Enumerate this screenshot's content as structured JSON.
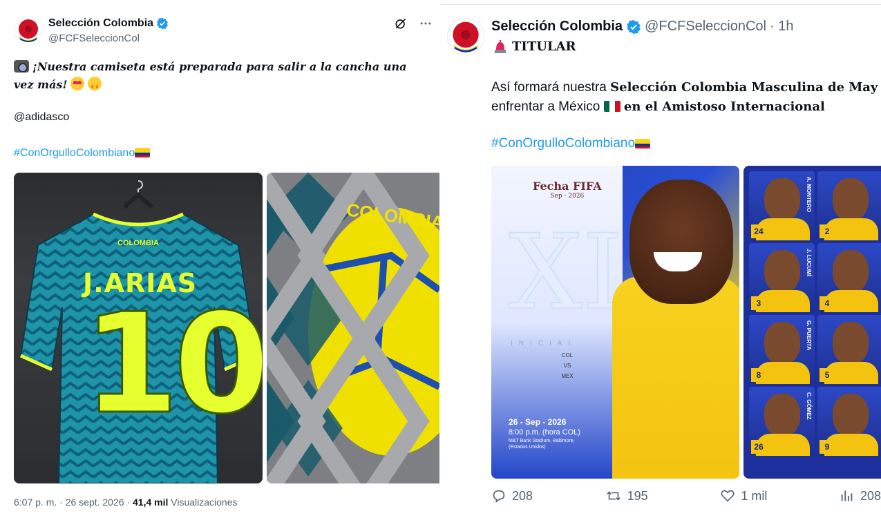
{
  "left_tweet": {
    "author_name": "Selección Colombia",
    "author_handle": "@FCFSeleccionCol",
    "text_line": "¡Nuestra camiseta está preparada para salir a la cancha una vez más!",
    "mention": "@adidasco",
    "hashtag": "#ConOrgulloColombiano",
    "jersey_name": "J.ARIAS",
    "jersey_number": "10",
    "jersey_badge": "COLOMBIA",
    "ball_text": "COLOMBIA",
    "timestamp": "6:07 p. m. · 26 sept. 2026 · ",
    "views_count": "41,4 mil",
    "views_label": " Visualizaciones",
    "icons": [
      "grok-icon",
      "more-icon",
      "verified-badge-icon"
    ]
  },
  "right_tweet": {
    "author_name": "Selección Colombia",
    "author_handle": "@FCFSeleccionCol",
    "time_ago": "· 1h",
    "titular": "TITULAR",
    "text_part1": "Así formará nuestra ",
    "text_bold1": "Selección Colombia Masculina de May",
    "text_part2": "enfrentar a México ",
    "text_bold2": "en el Amistoso Internacional",
    "hashtag": "#ConOrgulloColombiano",
    "poster": {
      "fecha_title": "Fecha FIFA",
      "fecha_sub": "Sep - 2026",
      "xi": "XI",
      "inicial": "INICIAL",
      "col": "COL",
      "vs": "VS",
      "mex": "MEX",
      "date": "26 - Sep - 2026",
      "time": "8:00 p.m. (hora COL)",
      "venue": "M&T Bank Stadium, Baltimore, (Estados Unidos)"
    },
    "players": [
      {
        "name": "A. MONTERO",
        "number": "24"
      },
      {
        "name": "",
        "number": "2"
      },
      {
        "name": "J. LUCUMÍ",
        "number": "3"
      },
      {
        "name": "",
        "number": "4"
      },
      {
        "name": "G. PUERTA",
        "number": "8"
      },
      {
        "name": "",
        "number": "5"
      },
      {
        "name": "C. GÓMEZ",
        "number": "26"
      },
      {
        "name": "",
        "number": "9"
      }
    ],
    "stats": {
      "replies": "208",
      "retweets": "195",
      "likes": "1 mil",
      "views": "208"
    }
  },
  "colors": {
    "link": "#1d9bf0",
    "verified": "#1d9bf0",
    "muted": "#536471",
    "jersey_accent": "#e6ff2e",
    "colombia_yellow": "#f3c310",
    "colombia_blue": "#1f3fae"
  }
}
